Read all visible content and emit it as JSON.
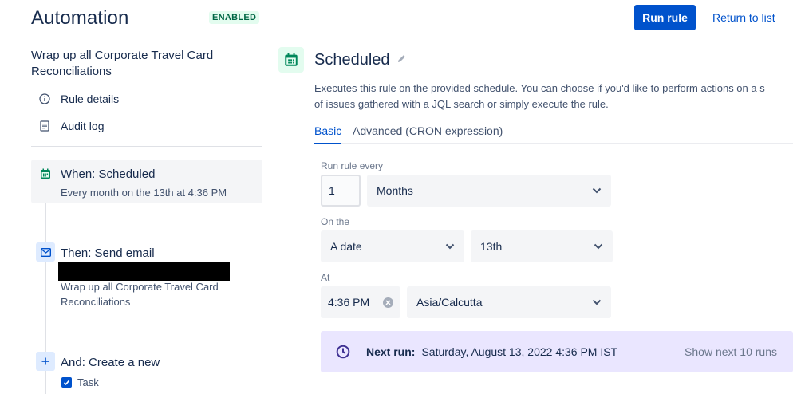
{
  "header": {
    "title": "Automation",
    "status_badge": "ENABLED",
    "run_button": "Run rule",
    "return_link": "Return to list"
  },
  "sidebar": {
    "rule_name": "Wrap up all Corporate Travel Card Reconciliations",
    "links": [
      {
        "label": "Rule details",
        "icon": "info-icon"
      },
      {
        "label": "Audit log",
        "icon": "document-icon"
      }
    ],
    "steps": [
      {
        "title": "When: Scheduled",
        "subtitle": "Every month on the 13th at 4:36 PM",
        "icon": "calendar-icon"
      },
      {
        "title": "Then: Send email",
        "subtitle": "Wrap up all Corporate Travel Card Reconciliations",
        "icon": "email-icon"
      },
      {
        "title": "And: Create a new",
        "subtitle": "Task",
        "icon": "plus-icon"
      }
    ]
  },
  "panel": {
    "title": "Scheduled",
    "description_line1": "Executes this rule on the provided schedule. You can choose if you'd like to perform actions on a s",
    "description_line2": "of issues gathered with a JQL search or simply execute the rule.",
    "tabs": [
      "Basic",
      "Advanced (CRON expression)"
    ],
    "active_tab": "Basic",
    "run_every_label": "Run rule every",
    "run_every_value": "1",
    "run_every_unit": "Months",
    "on_the_label": "On the",
    "on_the_type": "A date",
    "on_the_day": "13th",
    "at_label": "At",
    "time_value": "4:36 PM",
    "timezone": "Asia/Calcutta",
    "next_run_label": "Next run:",
    "next_run_value": "Saturday, August 13, 2022 4:36 PM IST",
    "show_next": "Show next 10 runs"
  },
  "colors": {
    "primary": "#0052cc",
    "enabled_bg": "#e3fcef",
    "enabled_text": "#006644",
    "next_run_bg": "#eae6ff",
    "calendar_green": "#00875a"
  }
}
